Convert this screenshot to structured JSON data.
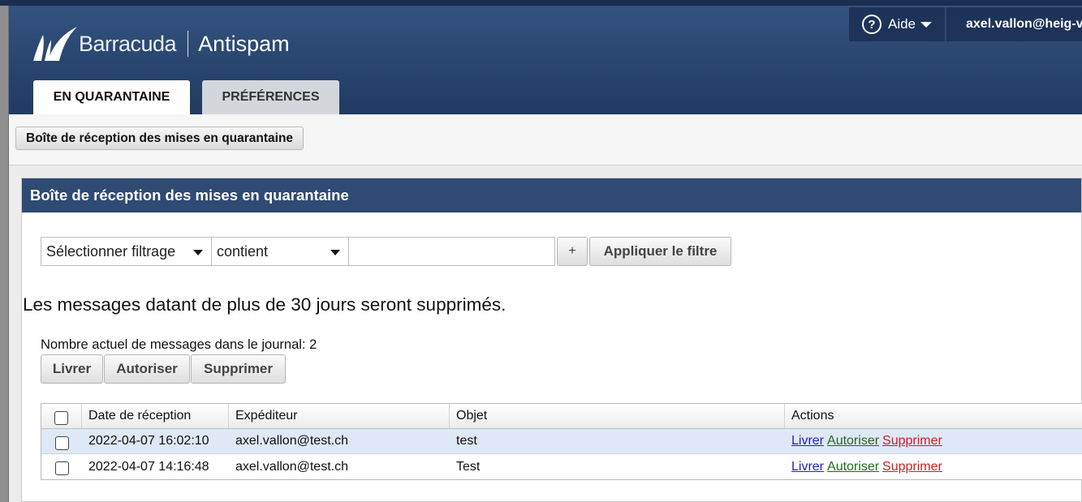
{
  "header": {
    "brand": "Barracuda",
    "product": "Antispam",
    "help_label": "Aide",
    "user_email": "axel.vallon@heig-vd.ch"
  },
  "tabs": [
    {
      "label": "EN QUARANTAINE",
      "active": true
    },
    {
      "label": "PRÉFÉRENCES",
      "active": false
    }
  ],
  "subnav": {
    "button_label": "Boîte de réception des mises en quarantaine"
  },
  "panel": {
    "title": "Boîte de réception des mises en quarantaine",
    "filter": {
      "field_select": "Sélectionner filtrage",
      "operator_select": "contient",
      "value": "",
      "plus_label": "+",
      "apply_label": "Appliquer le filtre"
    },
    "notice": "Les messages datant de plus de 30 jours seront supprimés.",
    "count_text": "Nombre actuel de messages dans le journal: 2",
    "actions": {
      "deliver": "Livrer",
      "allow": "Autoriser",
      "delete": "Supprimer"
    },
    "table": {
      "columns": [
        "Date de réception",
        "Expéditeur",
        "Objet",
        "Actions"
      ],
      "rows": [
        {
          "date": "2022-04-07 16:02:10",
          "sender": "axel.vallon@test.ch",
          "subject": "test",
          "selected": false,
          "highlight": true
        },
        {
          "date": "2022-04-07 14:16:48",
          "sender": "axel.vallon@test.ch",
          "subject": "Test",
          "selected": false,
          "highlight": false
        }
      ],
      "row_actions": [
        "Livrer",
        "Autoriser",
        "Supprimer"
      ]
    }
  },
  "colors": {
    "header_bg": "#27446e",
    "panel_header_bg": "#2f4a73",
    "link_livrer": "#1e22c8",
    "link_autoriser": "#1f6b1f",
    "link_supprimer": "#d11e1e",
    "row_highlight": "#dfe8f6"
  }
}
